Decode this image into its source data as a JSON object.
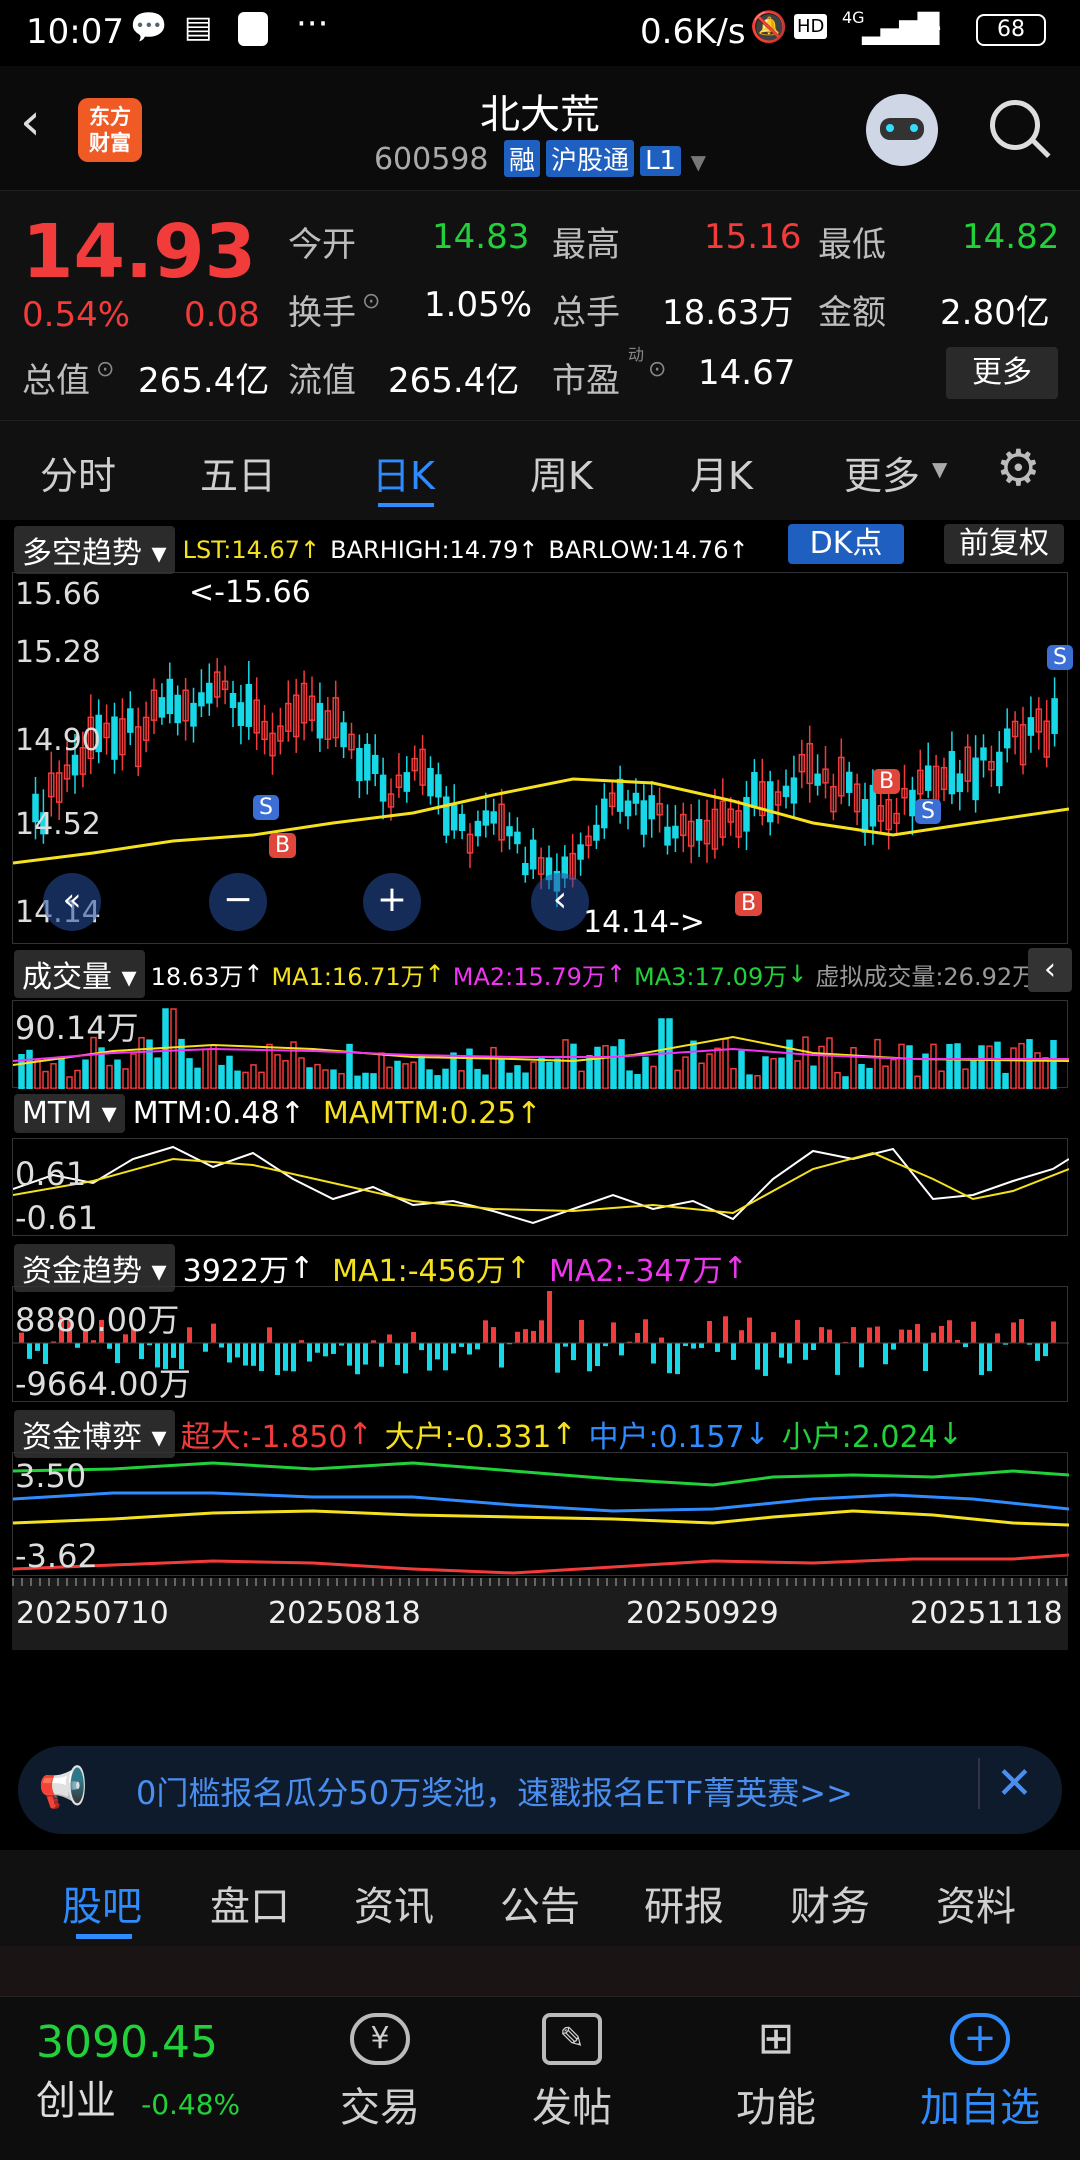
{
  "status_bar": {
    "time": "10:07",
    "net_speed": "0.6K/s",
    "battery": "68",
    "signal_label": "4G",
    "hd_label": "HD"
  },
  "header": {
    "logo_text": "东方\n财富",
    "title": "北大荒",
    "code": "600598",
    "tags": [
      "融",
      "沪股通",
      "L1"
    ]
  },
  "quote": {
    "price": "14.93",
    "change_pct": "0.54%",
    "change": "0.08",
    "open_label": "今开",
    "open": "14.83",
    "high_label": "最高",
    "high": "15.16",
    "low_label": "最低",
    "low": "14.82",
    "turnover_label": "换手",
    "turnover": "1.05%",
    "volume_label": "总手",
    "volume": "18.63万",
    "amount_label": "金额",
    "amount": "2.80亿",
    "total_value_label": "总值",
    "total_value": "265.4亿",
    "float_value_label": "流值",
    "float_value": "265.4亿",
    "pe_label": "市盈",
    "pe_sup": "动",
    "pe": "14.67",
    "more_button": "更多"
  },
  "k_tabs": [
    "分时",
    "五日",
    "日K",
    "周K",
    "月K",
    "更多"
  ],
  "k_tabs_active": "日K",
  "main_chart": {
    "indicator_select": "多空趋势",
    "lst": "LST:14.67",
    "barhigh": "BARHIGH:14.79",
    "barlow": "BARLOW:14.76",
    "dk_button": "DK点",
    "adjust_button": "前复权",
    "y_labels": [
      "15.66",
      "15.28",
      "14.90",
      "14.52",
      "14.14"
    ],
    "max_annot": "<-15.66",
    "min_annot": "14.14->"
  },
  "volume_panel": {
    "label": "成交量",
    "value": "18.63万",
    "ma1": "MA1:16.71万",
    "ma2": "MA2:15.79万",
    "ma3": "MA3:17.09万",
    "virtual": "虚拟成交量:26.92万",
    "y_max": "90.14万"
  },
  "mtm_panel": {
    "label": "MTM",
    "mtm": "MTM:0.48",
    "mamtm": "MAMTM:0.25",
    "y_top": "0.61",
    "y_bottom": "-0.61"
  },
  "fund_panel": {
    "label": "资金趋势",
    "value": "3922万",
    "ma1": "MA1:-456万",
    "ma2": "MA2:-347万",
    "y_top": "8880.00万",
    "y_bottom": "-9664.00万"
  },
  "game_panel": {
    "label": "资金博弈",
    "super": "超大:-1.850",
    "big": "大户:-0.331",
    "mid": "中户:0.157",
    "small": "小户:2.024",
    "y_top": "3.50",
    "y_bottom": "-3.62"
  },
  "x_dates": [
    "20250710",
    "20250818",
    "20250929",
    "20251118"
  ],
  "ad": {
    "text": "0门槛报名瓜分50万奖池，速戳报名ETF菁英赛>>"
  },
  "bottom_tabs": [
    "股吧",
    "盘口",
    "资讯",
    "公告",
    "研报",
    "财务",
    "资料"
  ],
  "bottom_tabs_active": "股吧",
  "index": {
    "value": "3090.45",
    "name": "创业",
    "change": "-0.48%"
  },
  "nav": [
    "交易",
    "发帖",
    "功能",
    "加自选"
  ],
  "colors": {
    "up": "#f23b3b",
    "down": "#22d13a",
    "cyan": "#17d8e6",
    "accent": "#2f8cff"
  }
}
